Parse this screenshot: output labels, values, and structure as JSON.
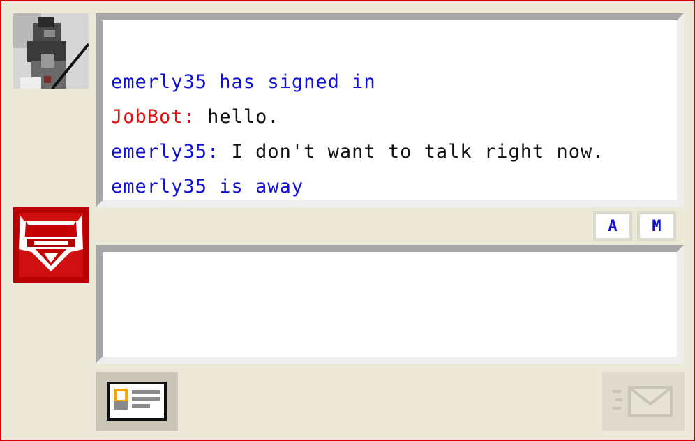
{
  "transcript": {
    "lines": [
      {
        "text": "emerly35 has signed in",
        "color": "#1010d8"
      },
      {
        "speaker": "JobBot:",
        "speaker_color": "#e01010",
        "text": "hello.",
        "text_color": "#111111"
      },
      {
        "speaker": "emerly35:",
        "speaker_color": "#1010d8",
        "text": "I don't want to talk right now.",
        "text_color": "#111111"
      },
      {
        "text": "emerly35 is away",
        "color": "#1010d8"
      }
    ]
  },
  "toolbar": {
    "font_label": "A",
    "emote_label": "M"
  },
  "icons": {
    "remote_avatar": "user-photo-icon",
    "self_avatar": "bot-logo-icon",
    "profile_card": "profile-card-icon",
    "send": "send-envelope-icon"
  },
  "colors": {
    "window_border": "#e00000",
    "background": "#ece9d8",
    "system_text": "#1010d8",
    "bot_name": "#e01010"
  }
}
